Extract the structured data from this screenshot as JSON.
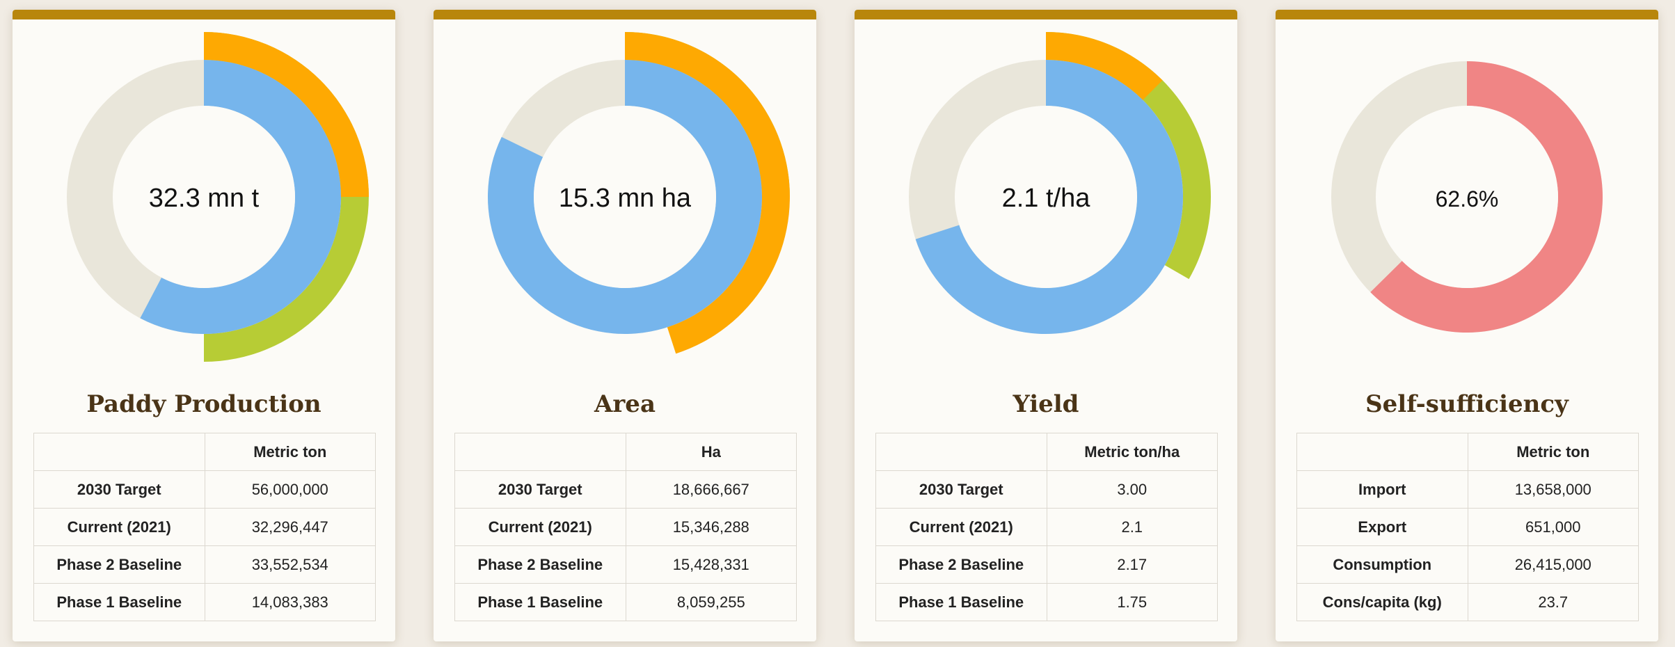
{
  "colors": {
    "target": "#b7cc35",
    "current": "#76b5ec",
    "baseline": "#fea902",
    "track": "#e9e6da",
    "selfsufficiency": "#f08585",
    "title": "#4a3417",
    "accent_bar": "#b8860b"
  },
  "cards": [
    {
      "title": "Paddy Production",
      "center_label": "32.3 mn t",
      "unit_header": "Metric ton",
      "rows": [
        {
          "label": "2030 Target",
          "value": "56,000,000"
        },
        {
          "label": "Current (2021)",
          "value": "32,296,447"
        },
        {
          "label": "Phase 2 Baseline",
          "value": "33,552,534"
        },
        {
          "label": "Phase 1 Baseline",
          "value": "14,083,383"
        }
      ]
    },
    {
      "title": "Area",
      "center_label": "15.3 mn ha",
      "unit_header": "Ha",
      "rows": [
        {
          "label": "2030 Target",
          "value": "18,666,667"
        },
        {
          "label": "Current (2021)",
          "value": "15,346,288"
        },
        {
          "label": "Phase 2 Baseline",
          "value": "15,428,331"
        },
        {
          "label": "Phase 1 Baseline",
          "value": "8,059,255"
        }
      ]
    },
    {
      "title": "Yield",
      "center_label": "2.1 t/ha",
      "unit_header": "Metric ton/ha",
      "rows": [
        {
          "label": "2030 Target",
          "value": "3.00"
        },
        {
          "label": "Current (2021)",
          "value": "2.1"
        },
        {
          "label": "Phase 2 Baseline",
          "value": "2.17"
        },
        {
          "label": "Phase 1 Baseline",
          "value": "1.75"
        }
      ]
    },
    {
      "title": "Self-sufficiency",
      "center_label": "62.6%",
      "unit_header": "Metric ton",
      "rows": [
        {
          "label": "Import",
          "value": "13,658,000"
        },
        {
          "label": "Export",
          "value": "651,000"
        },
        {
          "label": "Consumption",
          "value": "26,415,000"
        },
        {
          "label": "Cons/capita (kg)",
          "value": "23.7"
        }
      ]
    }
  ],
  "chart_data": [
    {
      "type": "donut",
      "title": "Paddy Production",
      "center_label": "32.3 mn t",
      "rings": [
        {
          "name": "2030 Target",
          "value": 56000000,
          "fraction_of_circle": 0.5
        },
        {
          "name": "Current (2021)",
          "value": 32296447,
          "fraction_of_circle": 0.577
        },
        {
          "name": "Phase 1 Baseline",
          "value": 14083383,
          "fraction_of_circle": 0.25
        }
      ]
    },
    {
      "type": "donut",
      "title": "Area",
      "center_label": "15.3 mn ha",
      "rings": [
        {
          "name": "2030 Target",
          "value": 18666667,
          "fraction_of_circle": 0.25
        },
        {
          "name": "Current (2021)",
          "value": 15346288,
          "fraction_of_circle": 0.822
        },
        {
          "name": "Phase 1 Baseline",
          "value": 8059255,
          "fraction_of_circle": 0.45
        }
      ]
    },
    {
      "type": "donut",
      "title": "Yield",
      "center_label": "2.1 t/ha",
      "rings": [
        {
          "name": "2030 Target",
          "value": 3.0,
          "fraction_of_circle": 0.333
        },
        {
          "name": "Current (2021)",
          "value": 2.1,
          "fraction_of_circle": 0.7
        },
        {
          "name": "Phase 1 Baseline",
          "value": 1.75,
          "fraction_of_circle": 0.125
        }
      ]
    },
    {
      "type": "donut",
      "title": "Self-sufficiency",
      "center_label": "62.6%",
      "rings": [
        {
          "name": "Self-sufficiency",
          "value": 62.6,
          "fraction_of_circle": 0.626
        }
      ]
    }
  ]
}
